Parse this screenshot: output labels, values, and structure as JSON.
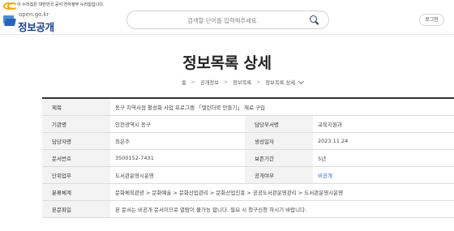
{
  "gov_banner": {
    "text": "이 누리집은 대한민국 공식 전자정부 누리집입니다."
  },
  "logo": {
    "url_text": "open.go.kr",
    "name": "정보공개"
  },
  "search": {
    "placeholder": "검색할 단어를 입력해주세요."
  },
  "header": {
    "login_label": "로그인"
  },
  "page": {
    "title": "정보목록 상세"
  },
  "breadcrumb": {
    "home": "홈",
    "level1": "공개정보",
    "level2": "정보목록",
    "current": "정보목록 상세"
  },
  "detail": {
    "labels": {
      "title": "제목",
      "agency": "기관명",
      "dept": "담당부서명",
      "manager": "담당자명",
      "created": "생성일자",
      "doc_no": "문서번호",
      "retention": "보존기간",
      "task": "단위업무",
      "disclosure": "공개여부",
      "classification": "분류체계",
      "body": "본문파일"
    },
    "values": {
      "title": "동구 지역서점 활성화 사업 프로그램 「캘린더북 만들기」 재료 구입",
      "agency": "인천광역시 동구",
      "dept": "교육지원과",
      "manager": "최은주",
      "created": "2023.11.24",
      "doc_no": "3500152-7431",
      "retention": "5년",
      "task": "도서관운영시운영",
      "disclosure": "비공개",
      "classification": "문화체육관광 > 문화예술 > 문화산업관리 > 문화산업진흥 > 공공도서관운영관리 > 도서관운영시운영",
      "body": "본 문서는 비공개 문서이므로 열람이 불가능 합니다. 필요 시 청구신청 하시기 바랍니다."
    }
  },
  "colors": {
    "brand": "#1a3f8f",
    "link": "#2b62c9",
    "header_bg": "#f3f3f3",
    "gov_mark": "#f2a900"
  },
  "icons": [
    "gov-emblem-icon",
    "folder-logo-icon",
    "search-icon",
    "chevron-down-icon"
  ]
}
